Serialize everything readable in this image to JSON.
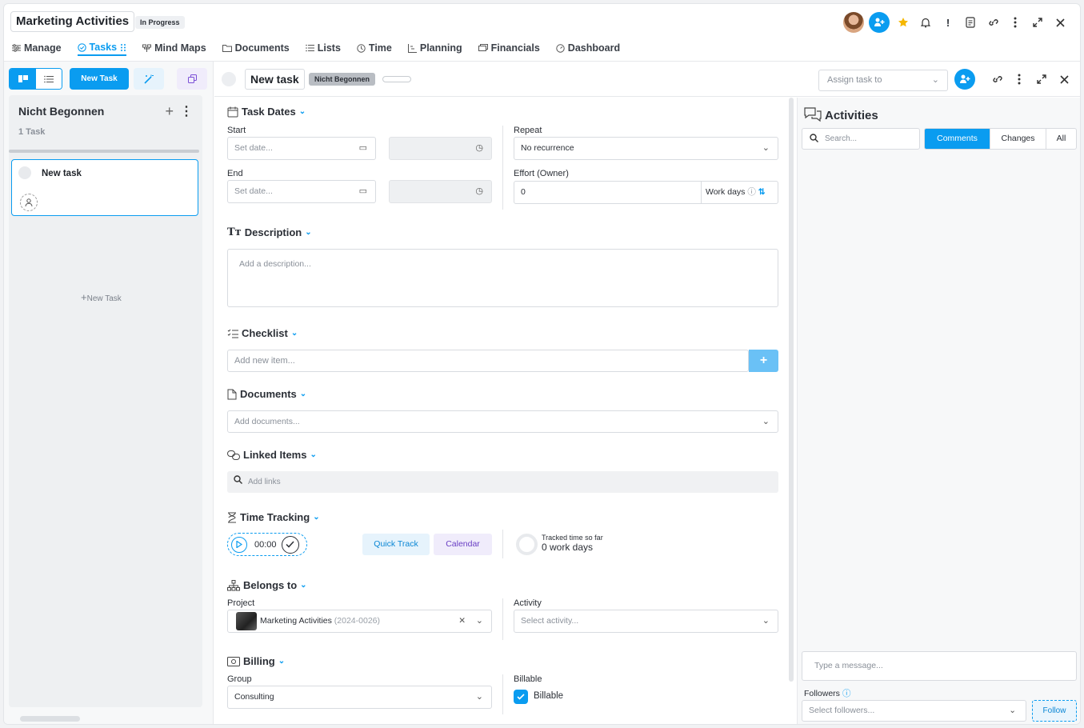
{
  "header": {
    "project_title": "Marketing Activities",
    "status": "In Progress",
    "tabs": [
      {
        "label": "Manage",
        "icon": "sliders-icon"
      },
      {
        "label": "Tasks",
        "icon": "check-circle-icon"
      },
      {
        "label": "Mind Maps",
        "icon": "mindmap-icon"
      },
      {
        "label": "Documents",
        "icon": "folder-icon"
      },
      {
        "label": "Lists",
        "icon": "list-icon"
      },
      {
        "label": "Time",
        "icon": "clock-icon"
      },
      {
        "label": "Planning",
        "icon": "gantt-icon"
      },
      {
        "label": "Financials",
        "icon": "money-icon"
      },
      {
        "label": "Dashboard",
        "icon": "dashboard-icon"
      }
    ]
  },
  "board": {
    "new_task_button": "New Task",
    "column": {
      "title": "Nicht Begonnen",
      "count": "1 Task",
      "cards": [
        {
          "title": "New task"
        }
      ],
      "new_task_link": "New Task"
    }
  },
  "task": {
    "title": "New task",
    "status": "Nicht Begonnen",
    "assign_placeholder": "Assign task to",
    "sections": {
      "dates": "Task Dates",
      "description": "Description",
      "checklist": "Checklist",
      "documents": "Documents",
      "linked": "Linked Items",
      "time_tracking": "Time Tracking",
      "belongs_to": "Belongs to",
      "billing": "Billing"
    },
    "dates": {
      "start_label": "Start",
      "end_label": "End",
      "date_placeholder": "Set date...",
      "repeat_label": "Repeat",
      "repeat_value": "No recurrence",
      "effort_label": "Effort (Owner)",
      "effort_value": "0",
      "effort_unit": "Work days"
    },
    "description_placeholder": "Add a description...",
    "checklist_placeholder": "Add new item...",
    "checklist_add": "+",
    "documents_placeholder": "Add documents...",
    "links_placeholder": "Add links",
    "time": {
      "timer": "00:00",
      "quick_track": "Quick Track",
      "calendar": "Calendar",
      "tracked_label": "Tracked time so far",
      "tracked_value": "0 work days"
    },
    "belongs": {
      "project_label": "Project",
      "project_name": "Marketing Activities",
      "project_code": "(2024-0026)",
      "activity_label": "Activity",
      "activity_placeholder": "Select activity..."
    },
    "billing": {
      "group_label": "Group",
      "group_value": "Consulting",
      "billable_label": "Billable",
      "billable_value": "Billable"
    }
  },
  "activities": {
    "title": "Activities",
    "search_placeholder": "Search...",
    "tabs": [
      "Comments",
      "Changes",
      "All"
    ],
    "message_placeholder": "Type a message...",
    "followers_label": "Followers",
    "followers_placeholder": "Select followers...",
    "follow_button": "Follow"
  },
  "colors": {
    "accent": "#0a9cf0",
    "purple": "#6a3fc4"
  }
}
